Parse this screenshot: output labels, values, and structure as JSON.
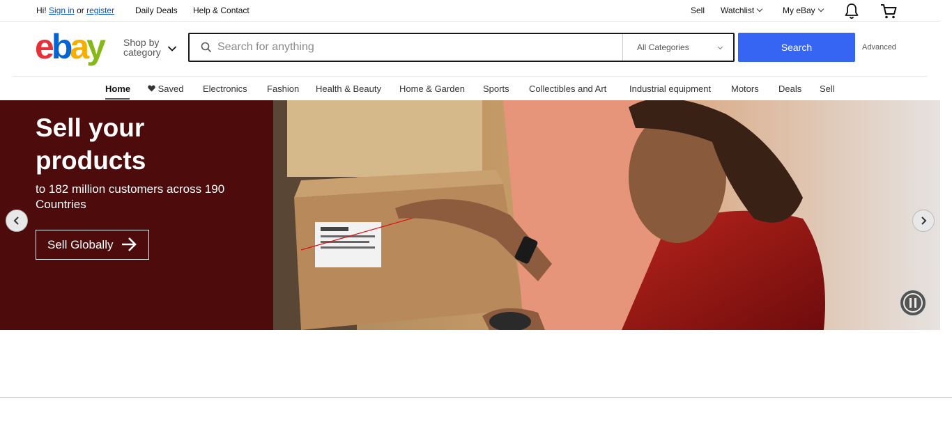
{
  "topbar": {
    "greeting_prefix": "Hi!",
    "sign_in": "Sign in",
    "or": "or",
    "register": "register",
    "daily_deals": "Daily Deals",
    "help_contact": "Help & Contact",
    "sell": "Sell",
    "watchlist": "Watchlist",
    "my_ebay": "My eBay"
  },
  "header": {
    "shop_by_line1": "Shop by",
    "shop_by_line2": "category",
    "search_placeholder": "Search for anything",
    "category_selected": "All Categories",
    "search_button": "Search",
    "advanced": "Advanced"
  },
  "nav": {
    "items": [
      "Home",
      "Saved",
      "Electronics",
      "Fashion",
      "Health & Beauty",
      "Home & Garden",
      "Sports",
      "Collectibles and Art",
      "Industrial equipment",
      "Motors",
      "Deals",
      "Sell"
    ]
  },
  "hero": {
    "title": "Sell your products",
    "subtitle": "to 182 million customers across 190 Countries",
    "cta": "Sell Globally"
  },
  "colors": {
    "search_blue": "#3665f3",
    "hero_bg": "#4d0b0b",
    "logo_e": "#e53238",
    "logo_b": "#0064d2",
    "logo_a": "#f5af02",
    "logo_y": "#86b817"
  },
  "icons": [
    "bell-icon",
    "cart-icon",
    "search-icon",
    "chevron-down-icon",
    "heart-icon",
    "arrow-right-icon",
    "chevron-left-icon",
    "chevron-right-icon",
    "pause-icon"
  ]
}
